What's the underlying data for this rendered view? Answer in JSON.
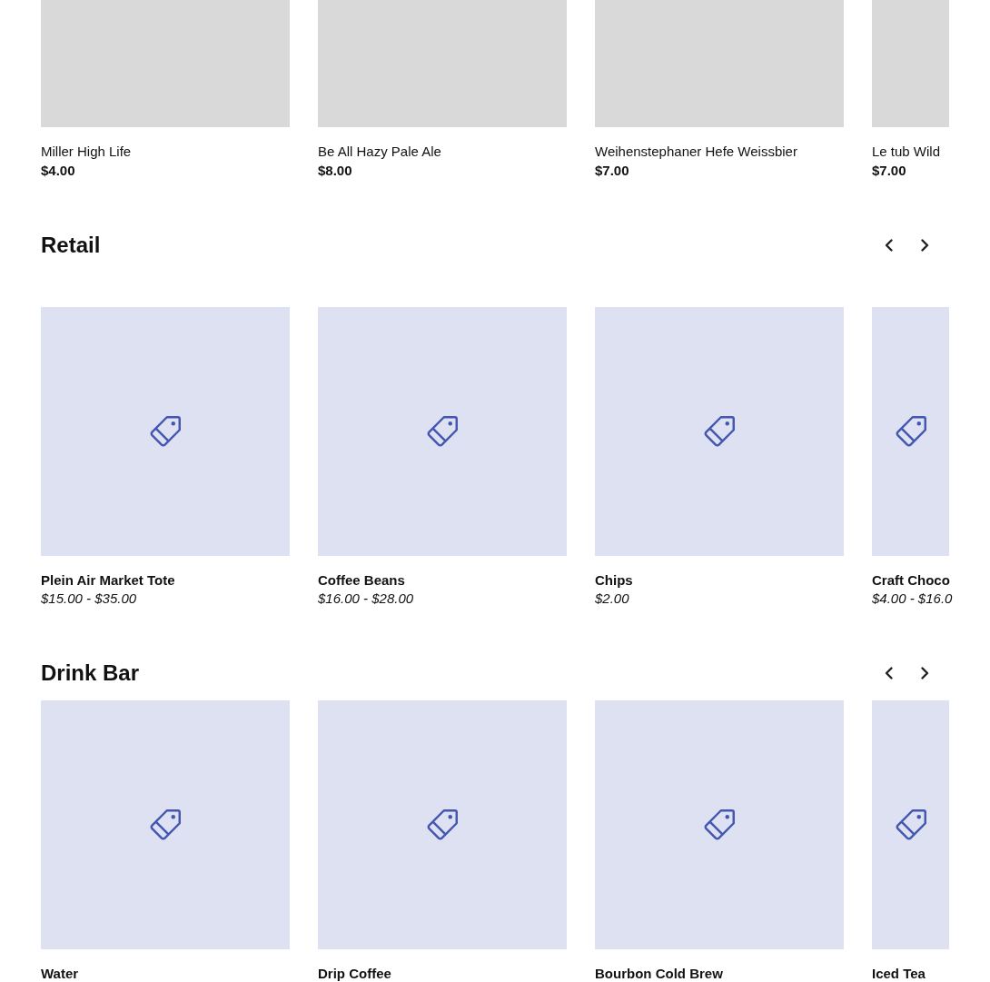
{
  "sections": [
    {
      "kind": "plain",
      "rows": [
        {
          "name": "Miller High Life",
          "price": "$4.00"
        },
        {
          "name": "Be All Hazy Pale Ale",
          "price": "$8.00"
        },
        {
          "name": "Weihenstephaner Hefe Weissbier",
          "price": "$7.00"
        },
        {
          "name": "Le tub Wild",
          "price": "$7.00"
        }
      ]
    },
    {
      "title": "Retail",
      "kind": "tag",
      "rows": [
        {
          "name": "Plein Air Market Tote",
          "price": "$15.00 - $35.00"
        },
        {
          "name": "Coffee Beans",
          "price": "$16.00 - $28.00"
        },
        {
          "name": "Chips",
          "price": "$2.00"
        },
        {
          "name": "Craft Choco",
          "price": "$4.00 - $16.0"
        }
      ]
    },
    {
      "title": "Drink Bar",
      "kind": "tag",
      "rows": [
        {
          "name": "Water"
        },
        {
          "name": "Drip Coffee"
        },
        {
          "name": "Bourbon Cold Brew"
        },
        {
          "name": "Iced Tea"
        }
      ]
    }
  ]
}
